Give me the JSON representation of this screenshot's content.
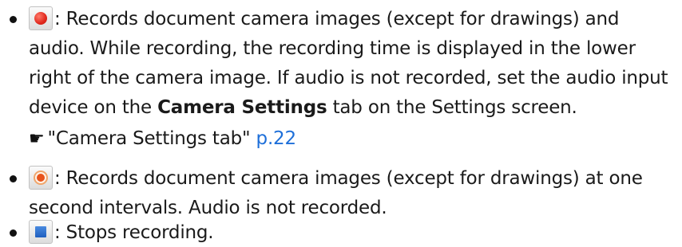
{
  "bullets": [
    {
      "icon": "record-audio-icon",
      "sep": ": ",
      "text_before": "Records document camera images (except for drawings) and audio. While recording, the recording time is displayed in the lower right of the camera image. If audio is not recorded, set the audio input device on the ",
      "bold": "Camera Settings",
      "text_after": " tab on the Settings screen."
    },
    {
      "icon": "record-interval-icon",
      "sep": ": ",
      "text": "Records document camera images (except for drawings) at one second intervals. Audio is not recorded."
    },
    {
      "icon": "stop-icon",
      "sep": ": ",
      "text": "Stops recording."
    }
  ],
  "xref": {
    "icon": "pointing-hand-icon",
    "label": "\"Camera Settings tab\"",
    "page": "p.22"
  },
  "colors": {
    "text": "#1a1a1a",
    "link": "#1e6fd9",
    "record_red": "#e0271c",
    "stop_blue": "#1f5fbf"
  }
}
